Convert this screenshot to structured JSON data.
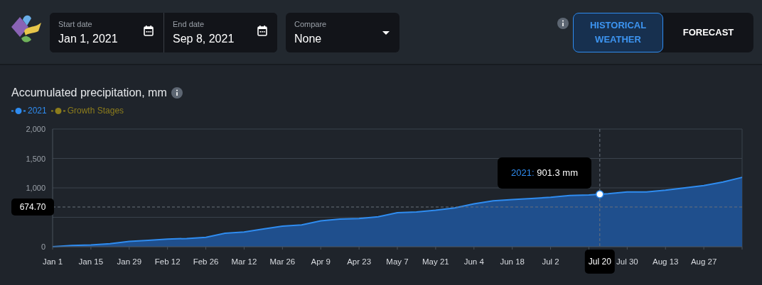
{
  "header": {
    "start_date": {
      "label": "Start date",
      "value": "Jan 1, 2021"
    },
    "end_date": {
      "label": "End date",
      "value": "Sep 8, 2021"
    },
    "compare": {
      "label": "Compare",
      "value": "None"
    },
    "modes": [
      {
        "label": "HISTORICAL WEATHER",
        "selected": true
      },
      {
        "label": "FORECAST",
        "selected": false
      }
    ]
  },
  "chart": {
    "title": "Accumulated precipitation, mm",
    "legend": [
      {
        "name": "Growth Stages",
        "color": "#8c7c1c"
      }
    ],
    "chart_data": {
      "type": "area",
      "ylim": [
        0,
        2000
      ],
      "categories": [
        "Jan 1",
        null,
        "Jan 15",
        null,
        "Jan 29",
        null,
        "Feb 12",
        null,
        "Feb 26",
        null,
        "Mar 12",
        null,
        "Mar 26",
        null,
        "Apr 9",
        null,
        "Apr 23",
        null,
        "May 7",
        null,
        "May 21",
        null,
        "Jun 4",
        null,
        "Jun 18",
        null,
        "Jul 2",
        null,
        null,
        null,
        "Jul 30",
        null,
        "Aug 13",
        null,
        "Aug 27",
        null,
        null
      ],
      "series": [
        {
          "name": "2021",
          "color": "#2f8cf0",
          "values": [
            0,
            20,
            30,
            50,
            90,
            110,
            130,
            140,
            160,
            230,
            250,
            300,
            350,
            370,
            440,
            470,
            480,
            510,
            580,
            590,
            620,
            660,
            730,
            780,
            800,
            820,
            840,
            870,
            880,
            900,
            930,
            930,
            960,
            1000,
            1040,
            1100,
            1180
          ]
        }
      ],
      "ref_lines": [
        {
          "axis": "y",
          "value": 674.7,
          "label": "674.70"
        }
      ],
      "yticks": [
        {
          "value": 0,
          "label": "0"
        },
        {
          "value": 1000,
          "label": "1,000"
        },
        {
          "value": 1500,
          "label": "1,500"
        },
        {
          "value": 2000,
          "label": "2,000"
        }
      ]
    },
    "cursor": {
      "x_label": "Jul 20",
      "tooltip_series": "2021:",
      "tooltip_value": "901.3 mm"
    }
  }
}
